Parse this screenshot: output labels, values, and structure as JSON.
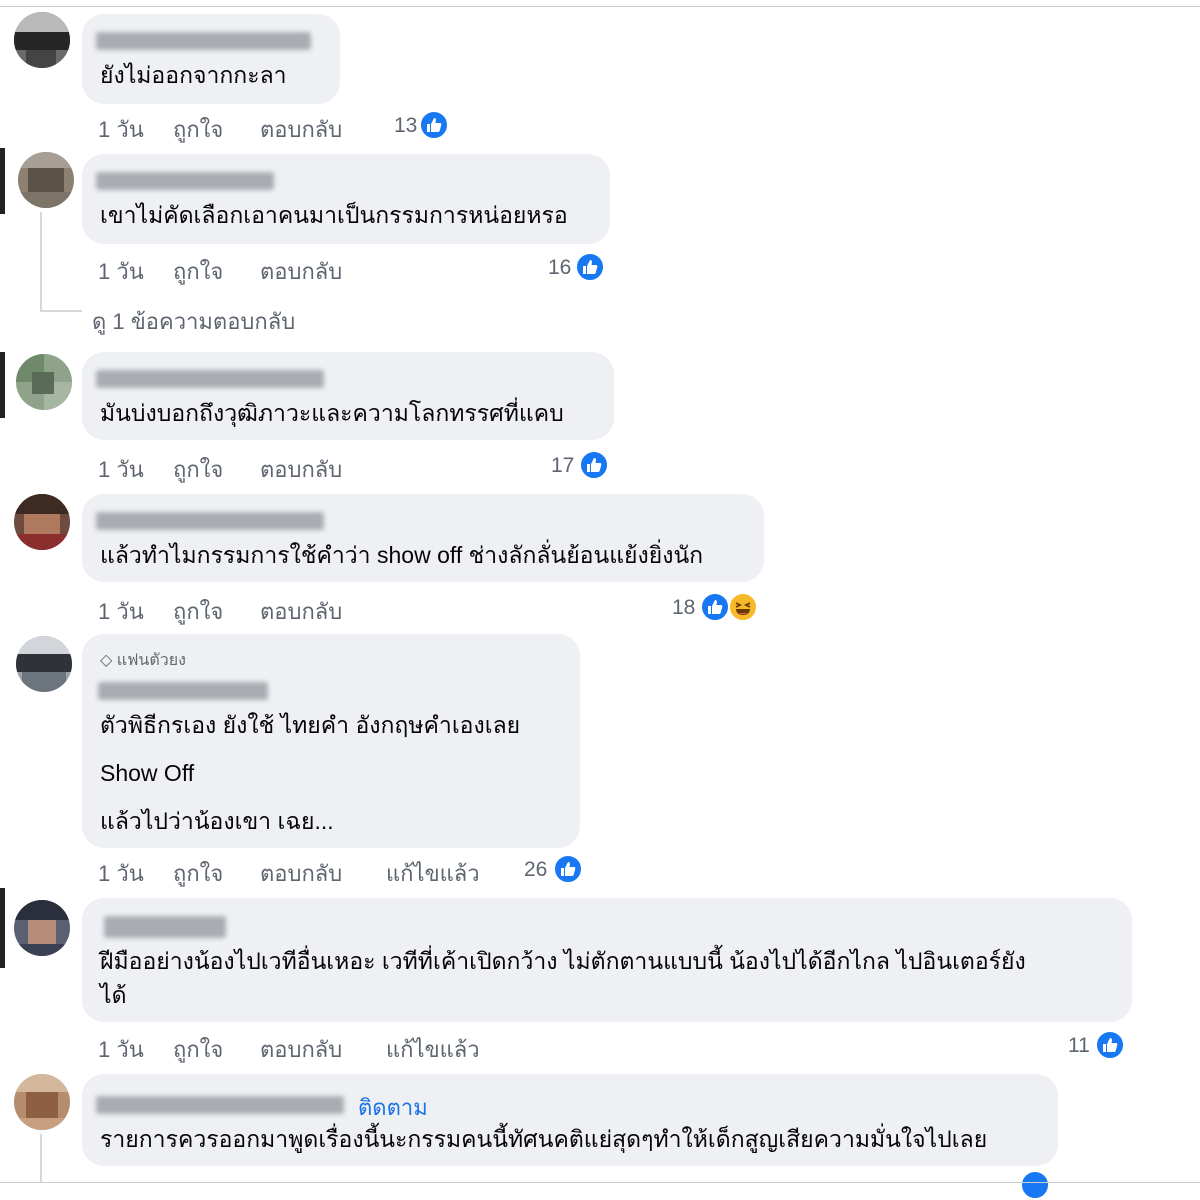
{
  "comments": [
    {
      "text": "ยังไม่ออกจากกะลา",
      "time": "1 วัน",
      "like": "ถูกใจ",
      "reply": "ตอบกลับ",
      "reactions": "13"
    },
    {
      "text": "เขาไม่คัดเลือกเอาคนมาเป็นกรรมการหน่อยหรอ",
      "time": "1 วัน",
      "like": "ถูกใจ",
      "reply": "ตอบกลับ",
      "reactions": "16",
      "view_replies": "ดู 1 ข้อความตอบกลับ"
    },
    {
      "text": "มันบ่งบอกถึงวุฒิภาวะและความโลกทรรศที่แคบ",
      "time": "1 วัน",
      "like": "ถูกใจ",
      "reply": "ตอบกลับ",
      "reactions": "17"
    },
    {
      "text": "แล้วทำไมกรรมการใช้คำว่า show off ช่างลักลั่นย้อนแย้งยิ่งนัก",
      "time": "1 วัน",
      "like": "ถูกใจ",
      "reply": "ตอบกลับ",
      "reactions": "18"
    },
    {
      "badge": "แฟนตัวยง",
      "line1": "ตัวพิธีกรเอง ยังใช้ ไทยคำ อังกฤษคำเองเลย",
      "line2": "Show Off",
      "line3": "แล้วไปว่าน้องเขา เฉย...",
      "time": "1 วัน",
      "like": "ถูกใจ",
      "reply": "ตอบกลับ",
      "edited": "แก้ไขแล้ว",
      "reactions": "26"
    },
    {
      "line1": "ฝีมืออย่างน้องไปเวทีอื่นเหอะ เวทีที่เค้าเปิดกว้าง ไม่ตักตานแบบนี้ น้องไปได้อีกไกล ไปอินเตอร์ยัง",
      "line2": "ได้",
      "time": "1 วัน",
      "like": "ถูกใจ",
      "reply": "ตอบกลับ",
      "edited": "แก้ไขแล้ว",
      "reactions": "11"
    },
    {
      "follow": "ติดตาม",
      "text": "รายการควรออกมาพูดเรื่องนี้นะกรรมคนนี้ทัศนคติแย่สุดๆทำให้เด็กสูญเสียความมั่นใจไปเลย"
    }
  ],
  "colors": {
    "bubble": "#eef0f3",
    "meta": "#5f6570",
    "like_blue": "#1877f2",
    "follow_blue": "#1b74e4"
  },
  "icons": [
    "like-icon",
    "haha-emoji-icon",
    "diamond-icon"
  ]
}
